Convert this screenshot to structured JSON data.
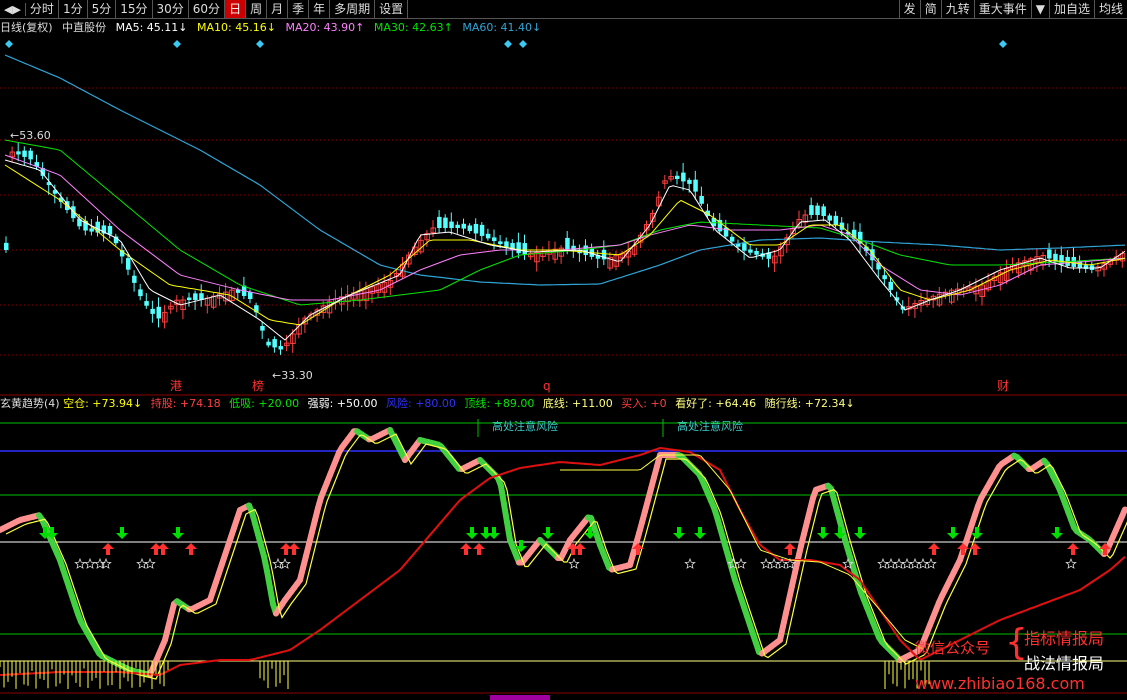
{
  "toolbar": {
    "arrow": "◀▶",
    "periods": [
      "分时",
      "1分",
      "5分",
      "15分",
      "30分",
      "60分",
      "日",
      "周",
      "月",
      "季",
      "年",
      "多周期",
      "设置"
    ],
    "active_index": 6,
    "right": [
      "发",
      "简",
      "九转",
      "重大事件",
      "▼",
      "加自选",
      "均线"
    ]
  },
  "main_info": {
    "title": "日线(复权)",
    "stock": "中直股份",
    "ma5": "MA5: 45.11↓",
    "ma10": "MA10: 45.16↓",
    "ma20": "MA20: 43.90↑",
    "ma30": "MA30: 42.63↑",
    "ma60": "MA60: 41.40↓"
  },
  "price_labels": {
    "high": "←53.60",
    "low": "←33.30"
  },
  "event_markers": [
    "港",
    "榜",
    "q",
    "财"
  ],
  "indicator": {
    "name": "玄黄趋势(4)",
    "kongcang": "空仓: +73.94↓",
    "chigu": "持股: +74.18",
    "dixi": "低吸: +20.00",
    "qiangruo": "强弱: +50.00",
    "fengxian": "风险: +80.00",
    "dingxian": "顶线: +89.00",
    "dixian": "底线: +11.00",
    "mairu": "买入: +0",
    "kanhao": "看好了: +64.46",
    "suixing": "随行线: +72.34↓",
    "risk_notes": [
      "高处注意风险",
      "高处注意风险"
    ]
  },
  "watermark": {
    "wechat": "微信公众号",
    "brand1": "指标情报局",
    "brand2": "战法情报局",
    "url": "www.zhibiao168.com"
  },
  "colors": {
    "up": "#ff4040",
    "down": "#54ffff",
    "ma5": "#ffffff",
    "ma10": "#ffff00",
    "ma20": "#ff80ff",
    "ma30": "#00e600",
    "ma60": "#2fa5d6"
  }
}
